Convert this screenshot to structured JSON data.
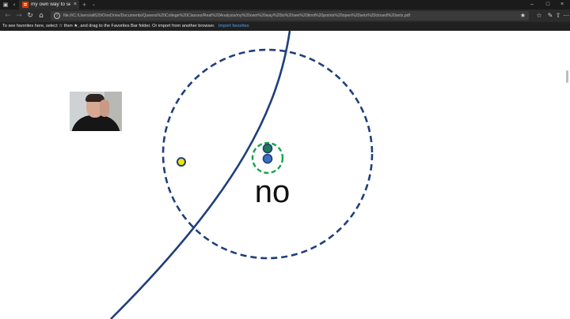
{
  "browser": {
    "tab": {
      "title": "my own way to see limi",
      "close_glyph": "×"
    },
    "new_tab_glyph": "+",
    "tab_menu_glyph": "⌄",
    "window_controls": [
      "–",
      "□",
      "×"
    ],
    "address": "file:///C:/Users/all620/OneDrive/Documents/Queens%20College%20Classes/Real%20Analysis/my%20own%20way%20to%20see%20limit%20points%20open%20sets%20closed%20sets.pdf"
  },
  "favorites_bar": {
    "message_prefix": "To see favorites here, select",
    "message_mid": "then ★, and drag to the Favorites Bar folder. Or import from another browser.",
    "import_link": "Import favorites"
  },
  "slide": {
    "answer_text": "no",
    "colors": {
      "navy": "#1f3f7a",
      "green": "#1aa34a",
      "teal_point": "#1f7a5a",
      "blue_point": "#3f6fc0",
      "yellow_point": "#f2e600"
    }
  },
  "icons": {
    "back": "back-arrow-icon",
    "forward": "forward-arrow-icon",
    "refresh": "refresh-icon",
    "home": "home-icon",
    "favorite": "star-icon",
    "reading_list": "reading-list-icon",
    "pen": "pen-icon",
    "share": "share-icon",
    "more": "more-icon"
  }
}
